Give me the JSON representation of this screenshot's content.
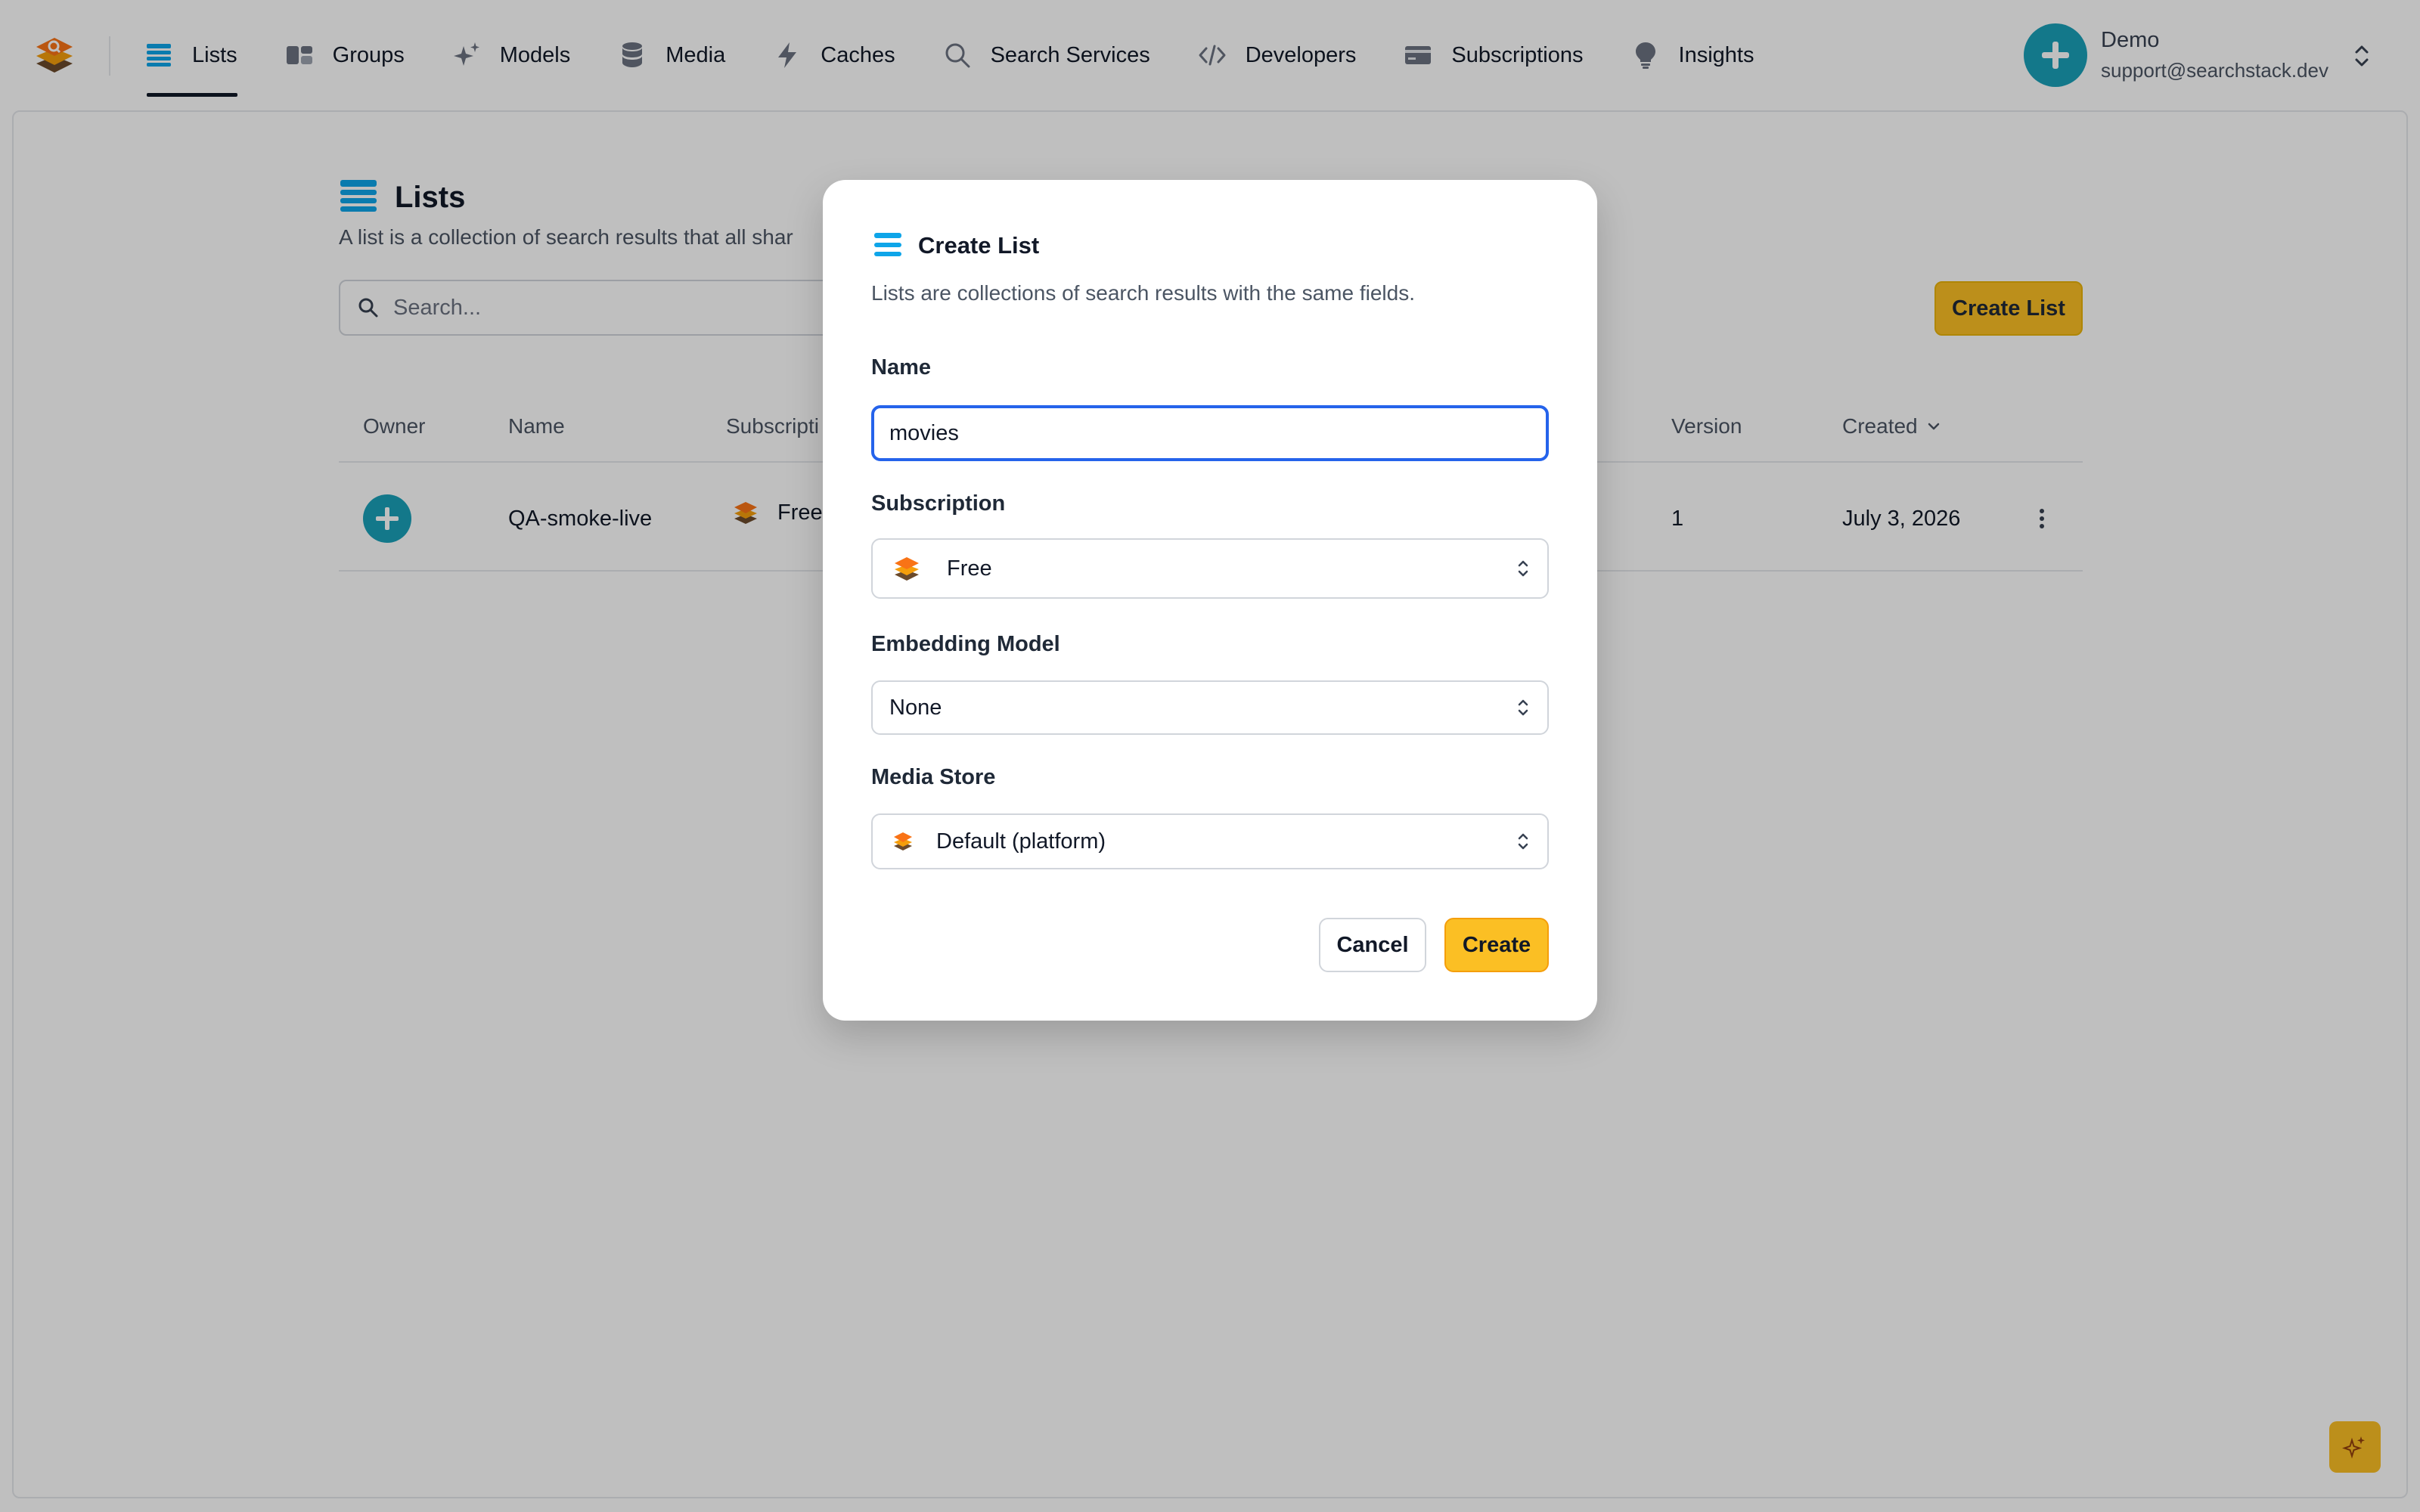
{
  "nav": {
    "items": [
      {
        "label": "Lists",
        "icon": "lists-icon",
        "active": true
      },
      {
        "label": "Groups",
        "icon": "groups-icon"
      },
      {
        "label": "Models",
        "icon": "sparkles-icon"
      },
      {
        "label": "Media",
        "icon": "database-icon"
      },
      {
        "label": "Caches",
        "icon": "bolt-icon"
      },
      {
        "label": "Search Services",
        "icon": "search-icon"
      },
      {
        "label": "Developers",
        "icon": "code-icon"
      },
      {
        "label": "Subscriptions",
        "icon": "credit-card-icon"
      },
      {
        "label": "Insights",
        "icon": "lightbulb-icon"
      }
    ],
    "user": {
      "name": "Demo",
      "email": "support@searchstack.dev"
    }
  },
  "page": {
    "title": "Lists",
    "description": "A list is a collection of search results that all shar",
    "search_placeholder": "Search...",
    "create_button": "Create List",
    "table": {
      "headers": {
        "owner": "Owner",
        "name": "Name",
        "subscription": "Subscripti",
        "version": "Version",
        "created": "Created"
      },
      "rows": [
        {
          "name": "QA-smoke-live",
          "subscription": "Free",
          "version": "1",
          "created": "July 3, 2026"
        }
      ]
    }
  },
  "modal": {
    "title": "Create List",
    "description": "Lists are collections of search results with the same fields.",
    "name_label": "Name",
    "name_value": "movies",
    "subscription_label": "Subscription",
    "subscription_value": "Free",
    "embedding_label": "Embedding Model",
    "embedding_value": "None",
    "media_store_label": "Media Store",
    "media_store_value": "Default (platform)",
    "cancel": "Cancel",
    "create": "Create"
  },
  "colors": {
    "accent": "#fbbf24",
    "focus": "#2563eb",
    "avatar": "#1aa0b8",
    "list_icon": "#0ea5e9"
  }
}
